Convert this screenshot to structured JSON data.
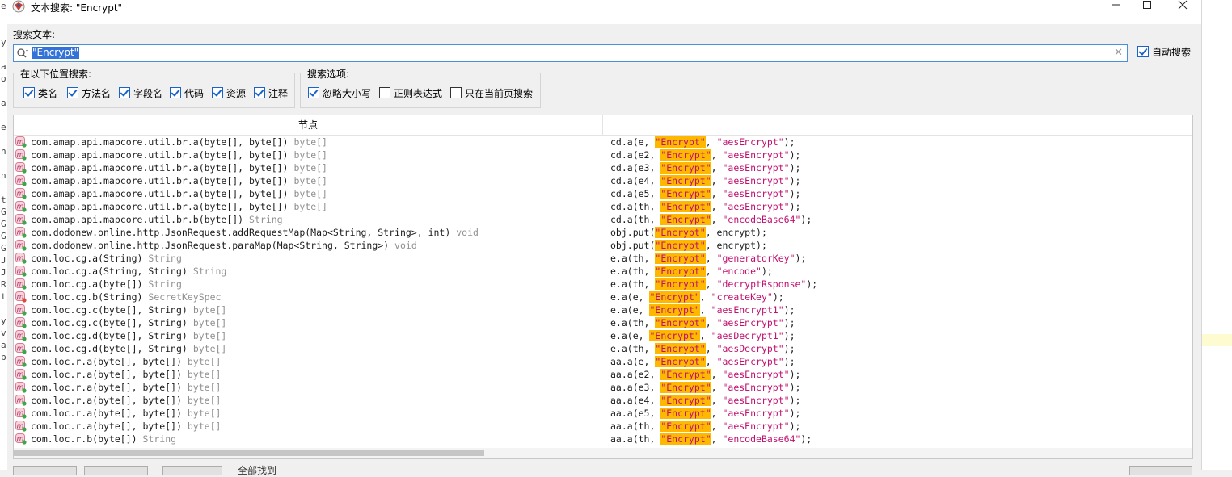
{
  "window": {
    "title": "文本搜索: \"Encrypt\"",
    "controls": [
      "minimize",
      "maximize",
      "close"
    ]
  },
  "search": {
    "label": "搜索文本:",
    "value": "\"Encrypt\"",
    "auto_search": {
      "label": "自动搜索",
      "checked": true
    }
  },
  "search_in": {
    "legend": "在以下位置搜索:",
    "options": [
      {
        "label": "类名",
        "checked": true
      },
      {
        "label": "方法名",
        "checked": true
      },
      {
        "label": "字段名",
        "checked": true
      },
      {
        "label": "代码",
        "checked": true
      },
      {
        "label": "资源",
        "checked": true
      },
      {
        "label": "注释",
        "checked": true
      }
    ]
  },
  "search_options": {
    "legend": "搜索选项:",
    "options": [
      {
        "label": "忽略大小写",
        "checked": true
      },
      {
        "label": "正则表达式",
        "checked": false
      },
      {
        "label": "只在当前页搜索",
        "checked": false
      }
    ]
  },
  "table": {
    "column_header": "节点",
    "rows": [
      {
        "icon": "method-icon",
        "node": "com.amap.api.mapcore.util.br.a(byte[], byte[])",
        "ret": "byte[]",
        "code": [
          "cd.a(e, ",
          "\"Encrypt\"",
          ", ",
          "\"aesEncrypt\"",
          ");"
        ]
      },
      {
        "icon": "method-icon",
        "node": "com.amap.api.mapcore.util.br.a(byte[], byte[])",
        "ret": "byte[]",
        "code": [
          "cd.a(e2, ",
          "\"Encrypt\"",
          ", ",
          "\"aesEncrypt\"",
          ");"
        ]
      },
      {
        "icon": "method-icon",
        "node": "com.amap.api.mapcore.util.br.a(byte[], byte[])",
        "ret": "byte[]",
        "code": [
          "cd.a(e3, ",
          "\"Encrypt\"",
          ", ",
          "\"aesEncrypt\"",
          ");"
        ]
      },
      {
        "icon": "method-icon",
        "node": "com.amap.api.mapcore.util.br.a(byte[], byte[])",
        "ret": "byte[]",
        "code": [
          "cd.a(e4, ",
          "\"Encrypt\"",
          ", ",
          "\"aesEncrypt\"",
          ");"
        ]
      },
      {
        "icon": "method-icon",
        "node": "com.amap.api.mapcore.util.br.a(byte[], byte[])",
        "ret": "byte[]",
        "code": [
          "cd.a(e5, ",
          "\"Encrypt\"",
          ", ",
          "\"aesEncrypt\"",
          ");"
        ]
      },
      {
        "icon": "method-icon",
        "node": "com.amap.api.mapcore.util.br.a(byte[], byte[])",
        "ret": "byte[]",
        "code": [
          "cd.a(th, ",
          "\"Encrypt\"",
          ", ",
          "\"aesEncrypt\"",
          ");"
        ]
      },
      {
        "icon": "method-icon",
        "node": "com.amap.api.mapcore.util.br.b(byte[])",
        "ret": "String",
        "code": [
          "cd.a(th, ",
          "\"Encrypt\"",
          ", ",
          "\"encodeBase64\"",
          ");"
        ]
      },
      {
        "icon": "method-icon",
        "node": "com.dodonew.online.http.JsonRequest.addRequestMap(Map<String, String>, int)",
        "ret": "void",
        "code": [
          "obj.put(",
          "\"Encrypt\"",
          ", encrypt);",
          "",
          ""
        ]
      },
      {
        "icon": "method-icon",
        "node": "com.dodonew.online.http.JsonRequest.paraMap(Map<String, String>)",
        "ret": "void",
        "code": [
          "obj.put(",
          "\"Encrypt\"",
          ", encrypt);",
          "",
          ""
        ]
      },
      {
        "icon": "method-icon",
        "node": "com.loc.cg.a(String)",
        "ret": "String",
        "code": [
          "e.a(th, ",
          "\"Encrypt\"",
          ", ",
          "\"generatorKey\"",
          ");"
        ]
      },
      {
        "icon": "method-icon",
        "node": "com.loc.cg.a(String, String)",
        "ret": "String",
        "code": [
          "e.a(th, ",
          "\"Encrypt\"",
          ", ",
          "\"encode\"",
          ");"
        ]
      },
      {
        "icon": "method-icon",
        "node": "com.loc.cg.a(byte[])",
        "ret": "String",
        "code": [
          "e.a(th, ",
          "\"Encrypt\"",
          ", ",
          "\"decryptRsponse\"",
          ");"
        ]
      },
      {
        "icon": "method-private-icon",
        "node": "com.loc.cg.b(String)",
        "ret": "SecretKeySpec",
        "code": [
          "e.a(e, ",
          "\"Encrypt\"",
          ", ",
          "\"createKey\"",
          ");"
        ]
      },
      {
        "icon": "method-icon",
        "node": "com.loc.cg.c(byte[], String)",
        "ret": "byte[]",
        "code": [
          "e.a(e, ",
          "\"Encrypt\"",
          ", ",
          "\"aesEncrypt1\"",
          ");"
        ]
      },
      {
        "icon": "method-icon",
        "node": "com.loc.cg.c(byte[], String)",
        "ret": "byte[]",
        "code": [
          "e.a(th, ",
          "\"Encrypt\"",
          ", ",
          "\"aesEncrypt\"",
          ");"
        ]
      },
      {
        "icon": "method-icon",
        "node": "com.loc.cg.d(byte[], String)",
        "ret": "byte[]",
        "code": [
          "e.a(e, ",
          "\"Encrypt\"",
          ", ",
          "\"aesDecrypt1\"",
          ");"
        ]
      },
      {
        "icon": "method-icon",
        "node": "com.loc.cg.d(byte[], String)",
        "ret": "byte[]",
        "code": [
          "e.a(th, ",
          "\"Encrypt\"",
          ", ",
          "\"aesDecrypt\"",
          ");"
        ]
      },
      {
        "icon": "method-icon",
        "node": "com.loc.r.a(byte[], byte[])",
        "ret": "byte[]",
        "code": [
          "aa.a(e, ",
          "\"Encrypt\"",
          ", ",
          "\"aesEncrypt\"",
          ");"
        ]
      },
      {
        "icon": "method-icon",
        "node": "com.loc.r.a(byte[], byte[])",
        "ret": "byte[]",
        "code": [
          "aa.a(e2, ",
          "\"Encrypt\"",
          ", ",
          "\"aesEncrypt\"",
          ");"
        ]
      },
      {
        "icon": "method-icon",
        "node": "com.loc.r.a(byte[], byte[])",
        "ret": "byte[]",
        "code": [
          "aa.a(e3, ",
          "\"Encrypt\"",
          ", ",
          "\"aesEncrypt\"",
          ");"
        ]
      },
      {
        "icon": "method-icon",
        "node": "com.loc.r.a(byte[], byte[])",
        "ret": "byte[]",
        "code": [
          "aa.a(e4, ",
          "\"Encrypt\"",
          ", ",
          "\"aesEncrypt\"",
          ");"
        ]
      },
      {
        "icon": "method-icon",
        "node": "com.loc.r.a(byte[], byte[])",
        "ret": "byte[]",
        "code": [
          "aa.a(e5, ",
          "\"Encrypt\"",
          ", ",
          "\"aesEncrypt\"",
          ");"
        ]
      },
      {
        "icon": "method-icon",
        "node": "com.loc.r.a(byte[], byte[])",
        "ret": "byte[]",
        "code": [
          "aa.a(th, ",
          "\"Encrypt\"",
          ", ",
          "\"aesEncrypt\"",
          ");"
        ]
      },
      {
        "icon": "method-icon",
        "node": "com.loc.r.b(byte[])",
        "ret": "String",
        "code": [
          "aa.a(th, ",
          "\"Encrypt\"",
          ", ",
          "\"encodeBase64\"",
          ");"
        ]
      }
    ]
  },
  "status": {
    "text": "全部找到"
  },
  "colors": {
    "highlight": "#ffb800",
    "string_literal": "#c01070",
    "selection": "#3372d8",
    "checkbox": "#1a64c8"
  }
}
